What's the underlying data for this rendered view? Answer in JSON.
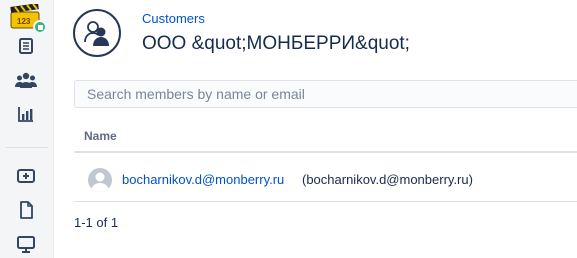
{
  "sidebar": {
    "items": [
      {
        "icon": "document-list-icon"
      },
      {
        "icon": "people-icon"
      },
      {
        "icon": "bar-chart-icon"
      },
      {
        "icon": "add-box-icon"
      },
      {
        "icon": "file-icon"
      },
      {
        "icon": "monitor-icon"
      }
    ],
    "colors": {
      "icon": "#344563",
      "badge": "#36b37e",
      "logo": "#f0c400"
    }
  },
  "header": {
    "breadcrumb": "Customers",
    "title": "ООО &quot;МОНБЕРРИ&quot;"
  },
  "search": {
    "placeholder": "Search members by name or email"
  },
  "table": {
    "columns": [
      "Name"
    ],
    "rows": [
      {
        "email": "bocharnikov.d@monberry.ru",
        "secondary": "(bocharnikov.d@monberry.ru)"
      }
    ]
  },
  "pagination": {
    "text": "1-1 of 1"
  },
  "accent_color": "#0052cc"
}
